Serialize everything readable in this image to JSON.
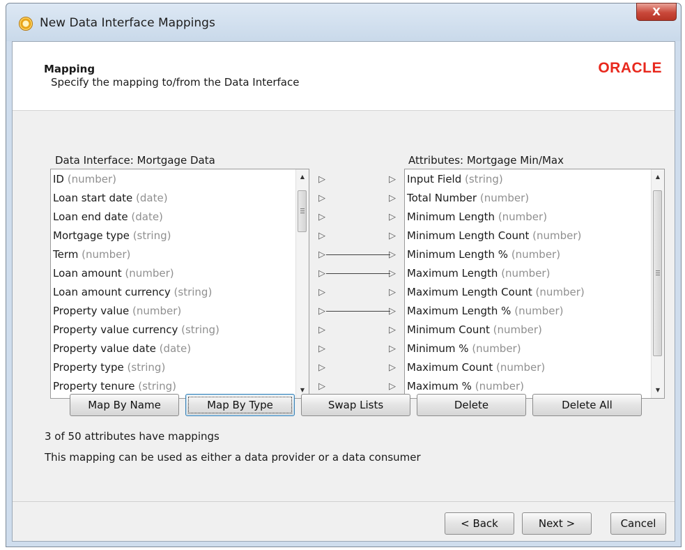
{
  "window": {
    "title": "New Data Interface Mappings",
    "close_label": "X"
  },
  "header": {
    "title": "Mapping",
    "subtitle": "Specify the mapping to/from the Data Interface",
    "logo_text": "ORACLE"
  },
  "left_list": {
    "label": "Data Interface: Mortgage Data",
    "items": [
      {
        "name": "ID",
        "type": "(number)"
      },
      {
        "name": "Loan start date",
        "type": "(date)"
      },
      {
        "name": "Loan end date",
        "type": "(date)"
      },
      {
        "name": "Mortgage type",
        "type": "(string)"
      },
      {
        "name": "Term",
        "type": "(number)"
      },
      {
        "name": "Loan amount",
        "type": "(number)"
      },
      {
        "name": "Loan amount currency",
        "type": "(string)"
      },
      {
        "name": "Property value",
        "type": "(number)"
      },
      {
        "name": "Property value currency",
        "type": "(string)"
      },
      {
        "name": "Property value date",
        "type": "(date)"
      },
      {
        "name": "Property type",
        "type": "(string)"
      },
      {
        "name": "Property tenure",
        "type": "(string)"
      }
    ]
  },
  "right_list": {
    "label": "Attributes: Mortgage Min/Max",
    "items": [
      {
        "name": "Input Field",
        "type": "(string)"
      },
      {
        "name": "Total Number",
        "type": "(number)"
      },
      {
        "name": "Minimum Length",
        "type": "(number)"
      },
      {
        "name": "Minimum Length Count",
        "type": "(number)"
      },
      {
        "name": "Minimum Length %",
        "type": "(number)"
      },
      {
        "name": "Maximum Length",
        "type": "(number)"
      },
      {
        "name": "Maximum Length Count",
        "type": "(number)"
      },
      {
        "name": "Maximum Length %",
        "type": "(number)"
      },
      {
        "name": "Minimum Count",
        "type": "(number)"
      },
      {
        "name": "Minimum %",
        "type": "(number)"
      },
      {
        "name": "Maximum Count",
        "type": "(number)"
      },
      {
        "name": "Maximum %",
        "type": "(number)"
      }
    ]
  },
  "mappings": [
    {
      "from": "Term",
      "to": "Minimum Length %"
    },
    {
      "from": "Loan amount",
      "to": "Maximum Length"
    },
    {
      "from": "Property value",
      "to": "Maximum Length %"
    }
  ],
  "buttons": {
    "map_by_name": "Map By Name",
    "map_by_type": "Map By Type",
    "swap_lists": "Swap Lists",
    "delete": "Delete",
    "delete_all": "Delete All"
  },
  "status": {
    "mapping_count": "3 of 50 attributes have mappings",
    "usage_note": "This mapping can be used as either a data provider or a data consumer"
  },
  "footer": {
    "back": "< Back",
    "next": "Next >",
    "cancel": "Cancel"
  },
  "colors": {
    "logo_red": "#e8281d",
    "type_gray": "#8f8f8f"
  }
}
